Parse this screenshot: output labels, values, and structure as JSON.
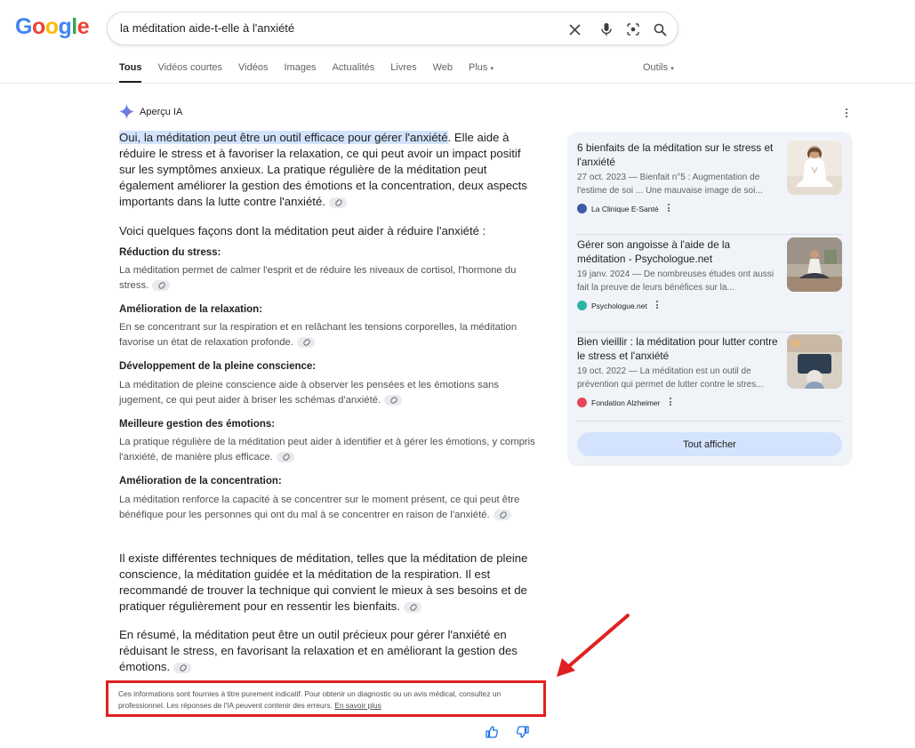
{
  "header": {
    "logo_text": "Google",
    "search_query": "la méditation aide-t-elle à l'anxiété",
    "tabs": [
      "Tous",
      "Vidéos courtes",
      "Vidéos",
      "Images",
      "Actualités",
      "Livres",
      "Web",
      "Plus"
    ],
    "tools": "Outils"
  },
  "ai": {
    "label": "Aperçu IA",
    "intro_highlight": "Oui, la méditation peut être un outil efficace pour gérer l'anxiété",
    "intro_rest": ". Elle aide à réduire le stress et à favoriser la relaxation, ce qui peut avoir un impact positif sur les symptômes anxieux. La pratique régulière de la méditation peut également améliorer la gestion des émotions et la concentration, deux aspects importants dans la lutte contre l'anxiété.",
    "lead": "Voici quelques façons dont la méditation peut aider à réduire l'anxiété :",
    "items": [
      {
        "heading": "Réduction du stress:",
        "text": "La méditation permet de calmer l'esprit et de réduire les niveaux de cortisol, l'hormone du stress."
      },
      {
        "heading": "Amélioration de la relaxation:",
        "text": "En se concentrant sur la respiration et en relâchant les tensions corporelles, la méditation favorise un état de relaxation profonde."
      },
      {
        "heading": "Développement de la pleine conscience:",
        "text": "La méditation de pleine conscience aide à observer les pensées et les émotions sans jugement, ce qui peut aider à briser les schémas d'anxiété."
      },
      {
        "heading": "Meilleure gestion des émotions:",
        "text": "La pratique régulière de la méditation peut aider à identifier et à gérer les émotions, y compris l'anxiété, de manière plus efficace."
      },
      {
        "heading": "Amélioration de la concentration:",
        "text": "La méditation renforce la capacité à se concentrer sur le moment présent, ce qui peut être bénéfique pour les personnes qui ont du mal à se concentrer en raison de l'anxiété."
      }
    ],
    "para1": "Il existe différentes techniques de méditation, telles que la méditation de pleine conscience, la méditation guidée et la méditation de la respiration. Il est recommandé de trouver la technique qui convient le mieux à ses besoins et de pratiquer régulièrement pour en ressentir les bienfaits.",
    "para2": "En résumé, la méditation peut être un outil précieux pour gérer l'anxiété en réduisant le stress, en favorisant la relaxation et en améliorant la gestion des émotions.",
    "disclaimer": "Ces informations sont fournies à titre purement indicatif. Pour obtenir un diagnostic ou un avis médical, consultez un professionnel. Les réponses de l'IA peuvent contenir des erreurs.",
    "learn_more": "En savoir plus"
  },
  "sources": [
    {
      "title": "6 bienfaits de la méditation sur le stress et l'anxiété",
      "snippet": "27 oct. 2023 — Bienfait n°5 : Augmentation de l'estime de soi ... Une mauvaise image de soi...",
      "site": "La Clinique E-Santé",
      "fav_color": "#3c5aa8"
    },
    {
      "title": "Gérer son angoisse à l'aide de la méditation - Psychologue.net",
      "snippet": "19 janv. 2024 — De nombreuses études ont aussi fait la preuve de leurs bénéfices sur la...",
      "site": "Psychologue.net",
      "fav_color": "#2bb3a5"
    },
    {
      "title": "Bien vieillir : la méditation pour lutter contre le stress et l'anxiété",
      "snippet": "19 oct. 2022 — La méditation est un outil de prévention qui permet de lutter contre le stres...",
      "site": "Fondation Alzheimer",
      "fav_color": "#e8455a"
    }
  ],
  "show_all": "Tout afficher",
  "colors": {
    "accent_blue": "#d3e3fd",
    "panel_bg": "#f0f4f9",
    "annotation_red": "#e02020"
  }
}
